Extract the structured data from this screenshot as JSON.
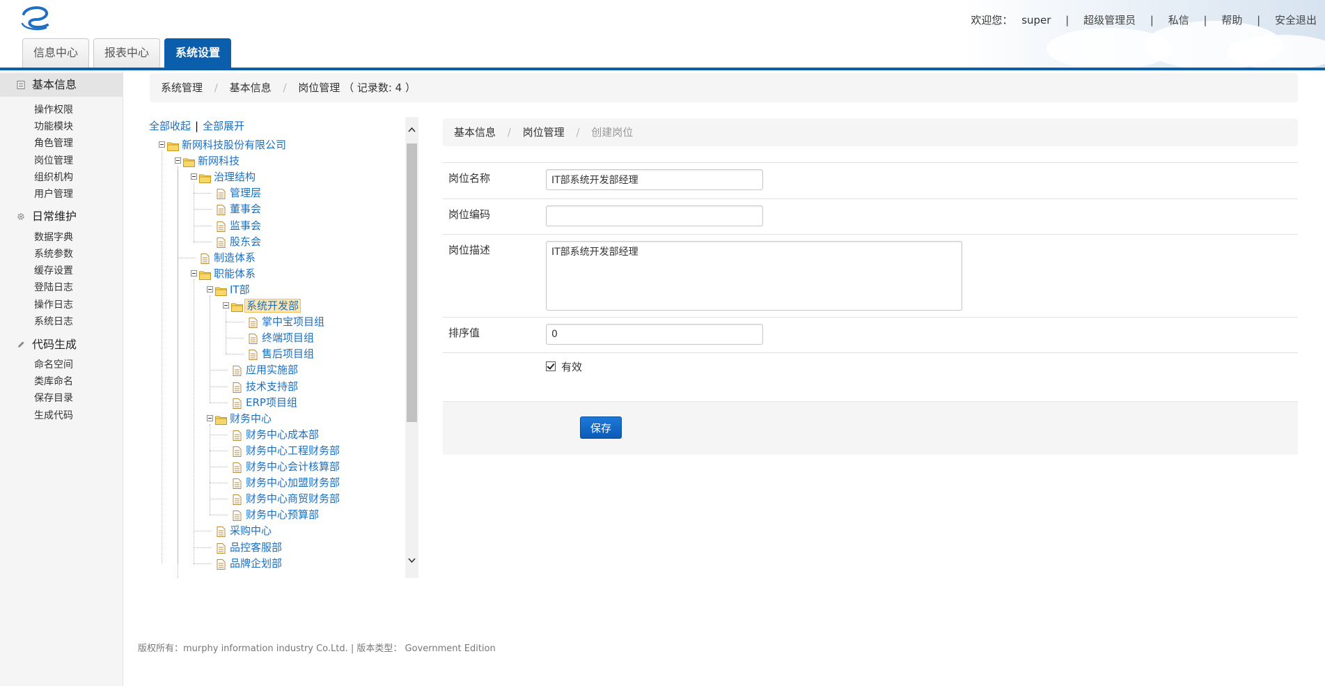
{
  "header": {
    "welcome": "欢迎您：",
    "user": "super",
    "links": [
      "超级管理员",
      "私信",
      "帮助",
      "安全退出"
    ],
    "tabs": [
      {
        "label": "信息中心"
      },
      {
        "label": "报表中心"
      },
      {
        "label": "系统设置",
        "active": true
      }
    ]
  },
  "sidebar": {
    "groups": [
      {
        "label": "基本信息",
        "icon": "document-icon",
        "selected": true,
        "items": [
          "操作权限",
          "功能模块",
          "角色管理",
          "岗位管理",
          "组织机构",
          "用户管理"
        ]
      },
      {
        "label": "日常维护",
        "icon": "gear-icon",
        "items": [
          "数据字典",
          "系统参数",
          "缓存设置",
          "登陆日志",
          "操作日志",
          "系统日志"
        ]
      },
      {
        "label": "代码生成",
        "icon": "pencil-icon",
        "items": [
          "命名空间",
          "类库命名",
          "保存目录",
          "生成代码"
        ]
      }
    ]
  },
  "breadcrumb": {
    "items": [
      "系统管理",
      "基本信息",
      "岗位管理"
    ],
    "record_text": "（ 记录数: 4 ）"
  },
  "tree": {
    "collapse_all": "全部收起",
    "expand_all": "全部展开",
    "nodes": [
      "新网科技股份有限公司",
      "新网科技",
      "治理结构",
      "管理层",
      "董事会",
      "监事会",
      "股东会",
      "制造体系",
      "职能体系",
      "IT部",
      "系统开发部",
      "掌中宝项目组",
      "终端项目组",
      "售后项目组",
      "应用实施部",
      "技术支持部",
      "ERP项目组",
      "财务中心",
      "财务中心成本部",
      "财务中心工程财务部",
      "财务中心会计核算部",
      "财务中心加盟财务部",
      "财务中心商贸财务部",
      "财务中心预算部",
      "采购中心",
      "品控客服部",
      "品牌企划部"
    ]
  },
  "form": {
    "breadcrumb": [
      "基本信息",
      "岗位管理",
      "创建岗位"
    ],
    "name_label": "岗位名称",
    "name_value": "IT部系统开发部经理",
    "code_label": "岗位编码",
    "code_value": "",
    "desc_label": "岗位描述",
    "desc_value": "IT部系统开发部经理",
    "sort_label": "排序值",
    "sort_value": "0",
    "valid_label": "有效",
    "valid_checked": true,
    "save_label": "保存"
  },
  "footer": {
    "text": "版权所有：murphy information industry Co.Ltd. | 版本类型： Government Edition"
  },
  "colors": {
    "brand_blue": "#0a5eab",
    "link_blue": "#1a6fc4",
    "folder_yellow": "#f3c24b",
    "selected_node_bg": "#ffe6b0"
  }
}
